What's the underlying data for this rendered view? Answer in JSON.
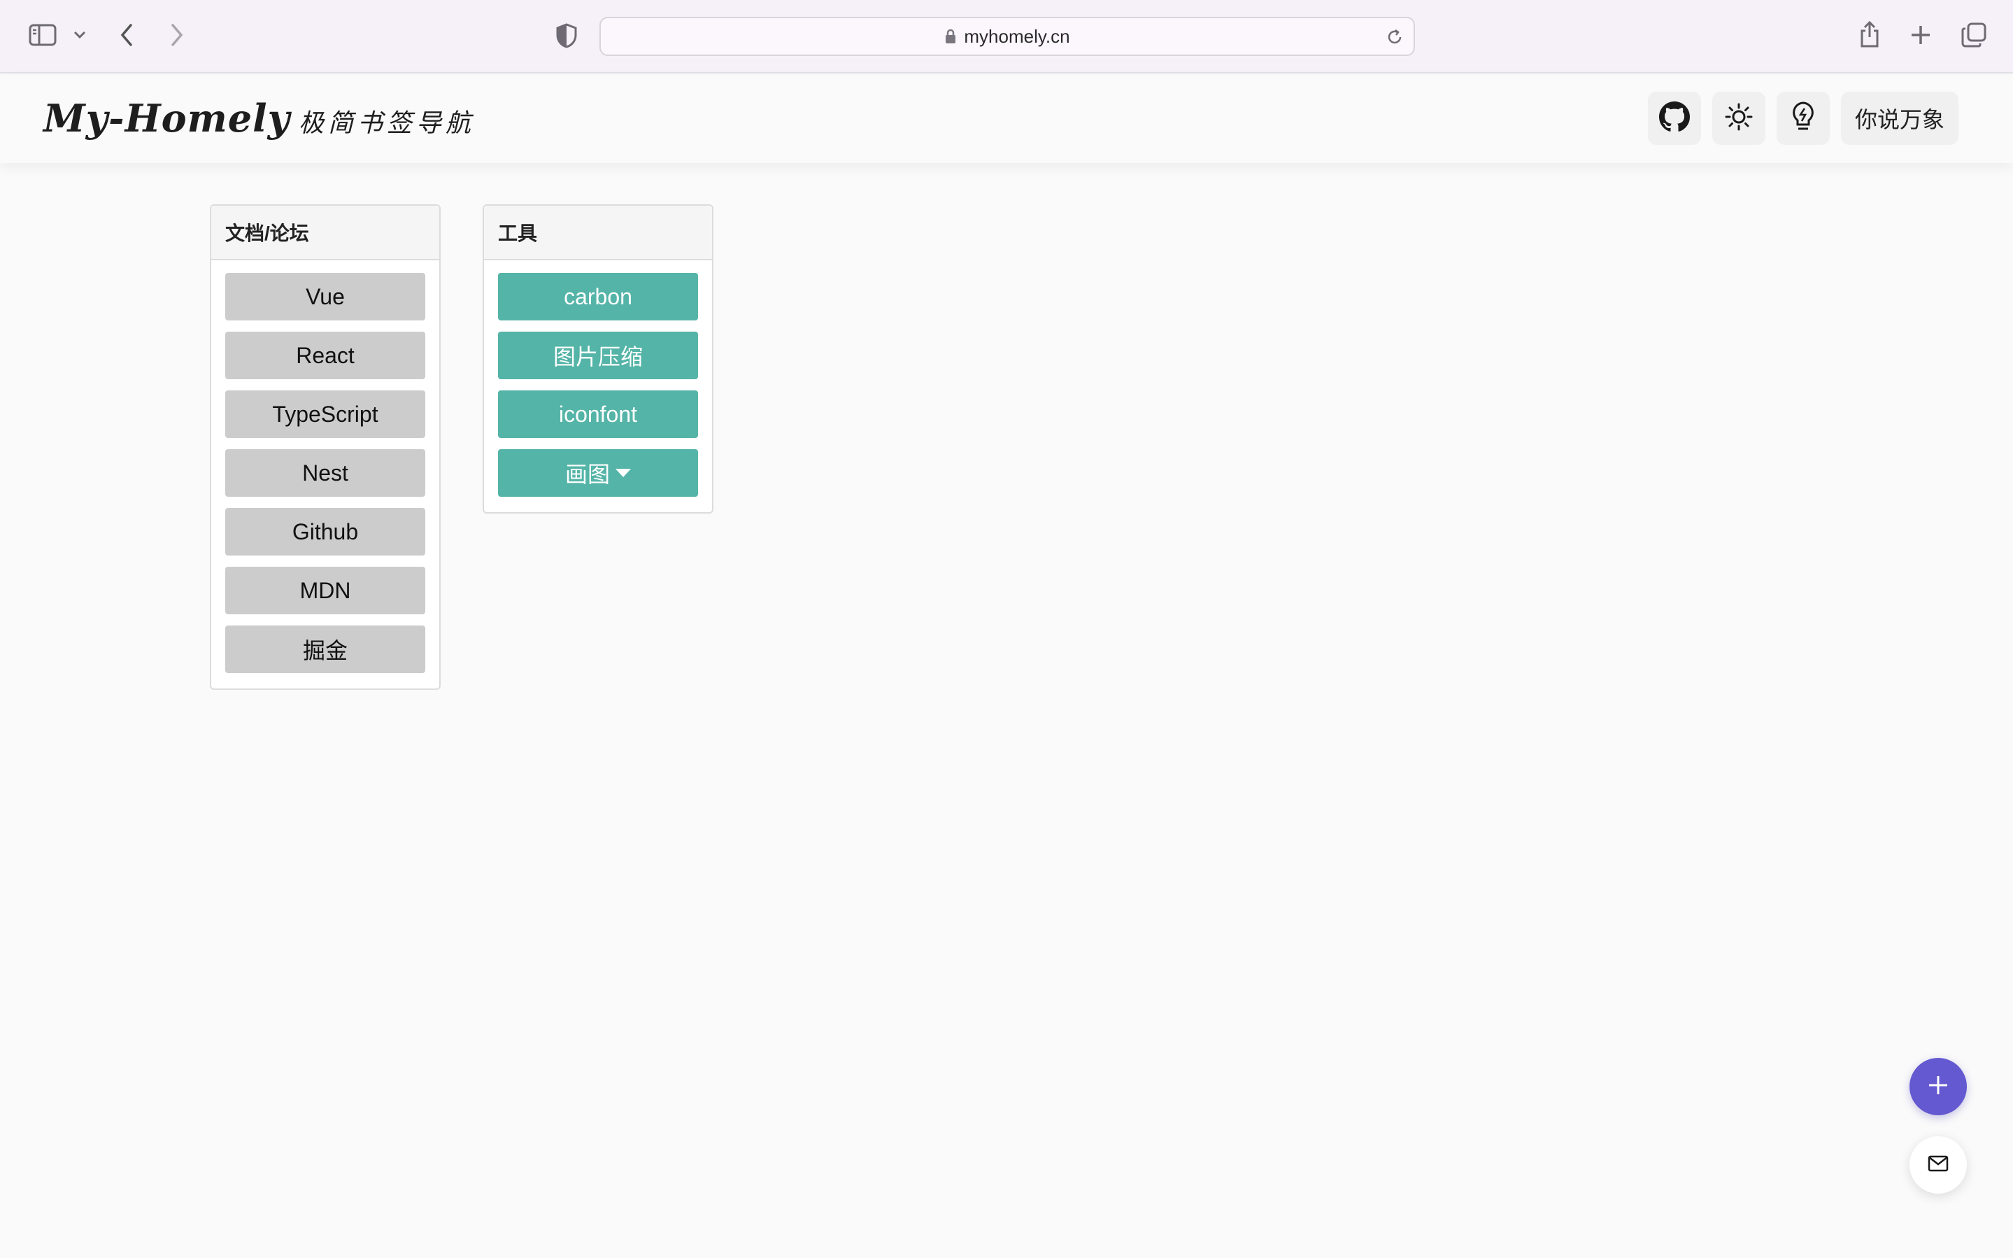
{
  "browser": {
    "url": "myhomely.cn",
    "icons": [
      "sidebar-icon",
      "chevron-down-icon",
      "back-icon",
      "forward-icon",
      "privacy-shield-icon",
      "lock-icon",
      "reload-icon",
      "share-icon",
      "new-tab-icon",
      "tabs-overview-icon"
    ]
  },
  "header": {
    "logo_main": "My-Homely",
    "logo_sub": "极简书签导航",
    "buttons": [
      "github-icon",
      "sun-icon",
      "lightbulb-icon"
    ],
    "quote_label": "你说万象"
  },
  "cards": [
    {
      "title": "文档/论坛",
      "style": "gray",
      "links": [
        "Vue",
        "React",
        "TypeScript",
        "Nest",
        "Github",
        "MDN",
        "掘金"
      ]
    },
    {
      "title": "工具",
      "style": "teal",
      "links": [
        "carbon",
        "图片压缩",
        "iconfont"
      ],
      "dropdown": "画图"
    }
  ],
  "fabs": [
    "plus-icon",
    "mail-icon"
  ],
  "colors": {
    "accent_teal": "#54b4a7",
    "gray_button": "#cccccc",
    "fab_purple": "#6459d0",
    "chrome_bg": "#f6f1f8"
  }
}
